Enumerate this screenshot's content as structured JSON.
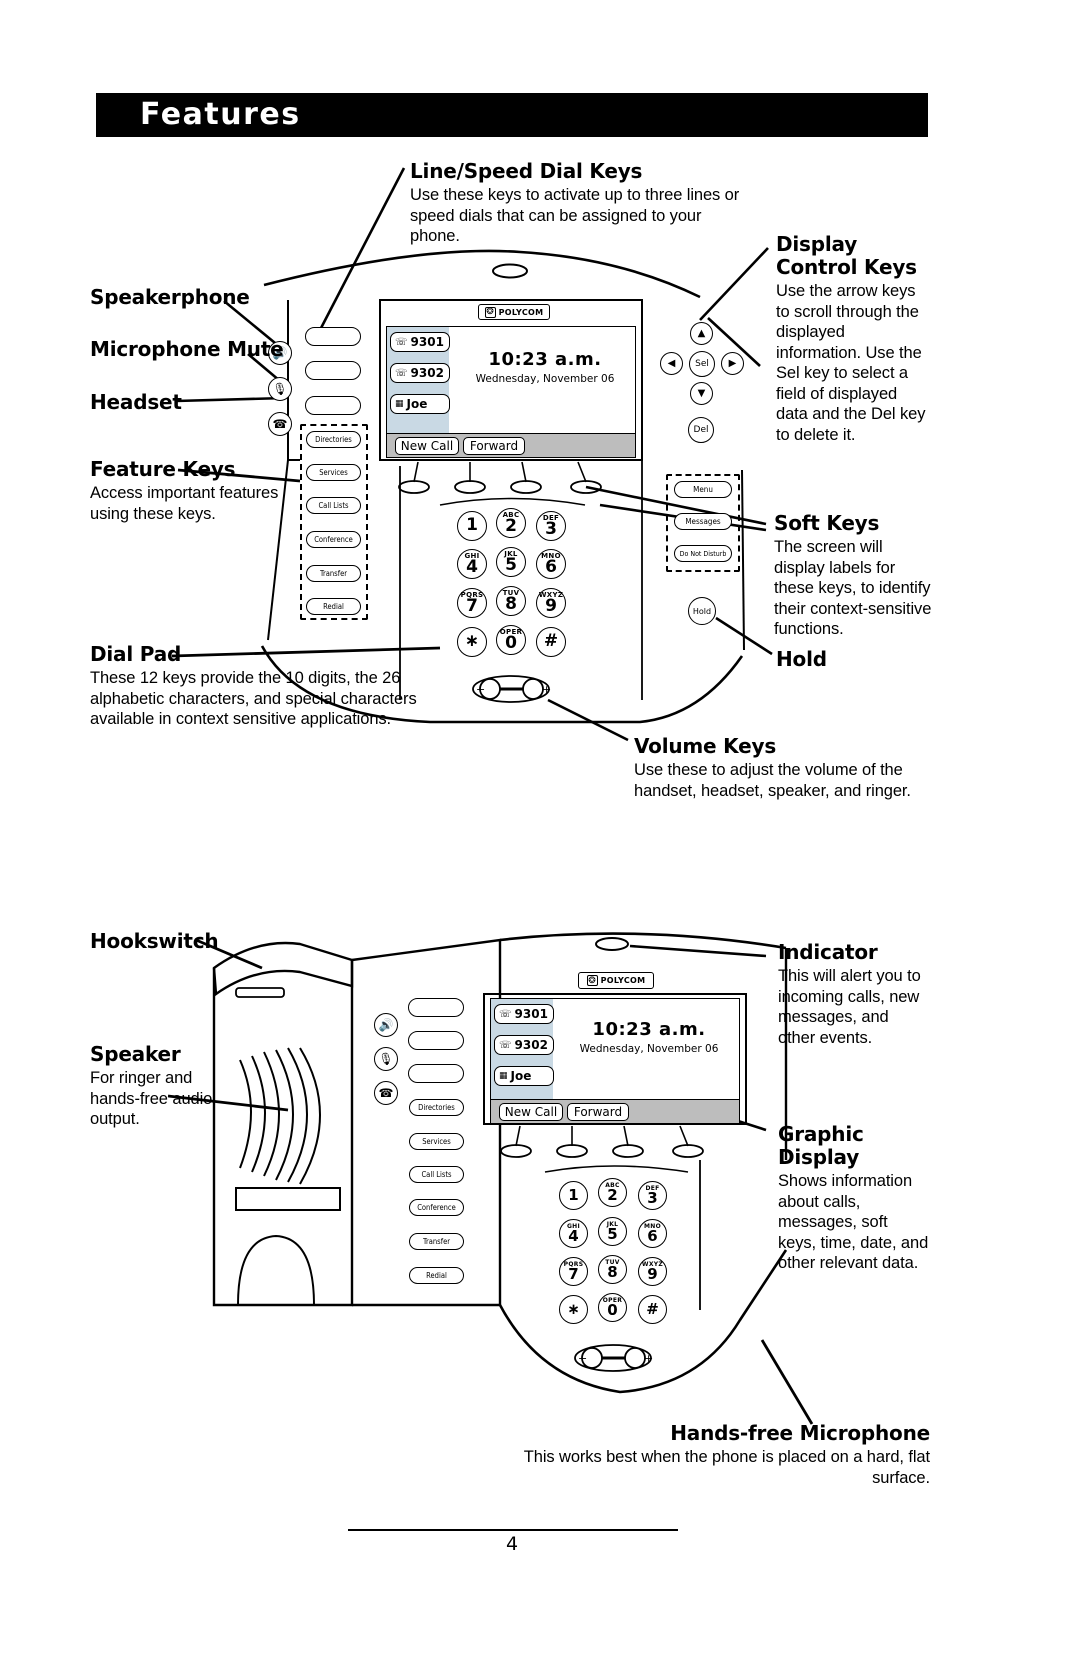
{
  "header": {
    "title": "Features"
  },
  "page_number": "4",
  "callouts": {
    "line_speed_dial": {
      "title": "Line/Speed Dial Keys",
      "body": "Use these keys to activate up to three lines or speed dials that can be assigned to your phone."
    },
    "display_control": {
      "title": "Display Control Keys",
      "body": "Use the arrow keys to scroll through the displayed information. Use the Sel key to select a field of displayed data and the Del key to delete it."
    },
    "speakerphone": {
      "title": "Speakerphone",
      "body": ""
    },
    "microphone_mute": {
      "title": "Microphone Mute",
      "body": ""
    },
    "headset": {
      "title": "Headset",
      "body": ""
    },
    "feature_keys": {
      "title": "Feature Keys",
      "body": "Access important features using these keys."
    },
    "soft_keys": {
      "title": "Soft Keys",
      "body": "The screen will display labels for these keys, to identify their context-sensitive functions."
    },
    "dial_pad": {
      "title": "Dial Pad",
      "body": "These 12 keys provide the 10 digits, the 26 alphabetic characters, and special characters available in context sensitive applications."
    },
    "hold": {
      "title": "Hold",
      "body": ""
    },
    "volume_keys": {
      "title": "Volume Keys",
      "body": "Use these to adjust the volume of the handset, headset, speaker, and ringer."
    },
    "hookswitch": {
      "title": "Hookswitch",
      "body": ""
    },
    "speaker": {
      "title": "Speaker",
      "body": "For ringer and hands-free audio output."
    },
    "indicator": {
      "title": "Indicator",
      "body": "This will alert you to incoming calls, new messages, and other events."
    },
    "graphic_display": {
      "title": "Graphic Display",
      "body": "Shows information about calls, messages, soft keys, time, date, and other relevant data."
    },
    "hands_free_microphone": {
      "title": "Hands-free Microphone",
      "body": "This works best when the phone is placed on a hard, flat surface."
    }
  },
  "phone": {
    "brand": "POLYCOM",
    "brand_mark": "polycom-logo-icon",
    "lcd": {
      "time": "10:23 a.m.",
      "date": "Wednesday, November 06",
      "line_keys": [
        {
          "icon": "handset-icon",
          "label": "9301"
        },
        {
          "icon": "handset-icon",
          "label": "9302"
        },
        {
          "icon": "keypad-icon",
          "label": "Joe"
        }
      ],
      "soft_keys": [
        "New Call",
        "Forward"
      ]
    },
    "side_icon_keys": [
      {
        "name": "speakerphone-icon",
        "glyph": "speaker"
      },
      {
        "name": "microphone-mute-icon",
        "glyph": "mic"
      },
      {
        "name": "headset-icon",
        "glyph": "headset"
      }
    ],
    "feature_keys": [
      "Directories",
      "Services",
      "Call Lists",
      "Conference",
      "Transfer",
      "Redial"
    ],
    "right_keys": [
      "Menu",
      "Messages",
      "Do Not Disturb"
    ],
    "hold_key": "Hold",
    "display_control": {
      "up": "up-arrow-icon",
      "down": "down-arrow-icon",
      "left": "left-arrow-icon",
      "right": "right-arrow-icon",
      "select": "Sel",
      "delete": "Del"
    },
    "dial_pad": [
      {
        "digit": "1",
        "letters": ""
      },
      {
        "digit": "2",
        "letters": "ABC"
      },
      {
        "digit": "3",
        "letters": "DEF"
      },
      {
        "digit": "4",
        "letters": "GHI"
      },
      {
        "digit": "5",
        "letters": "JKL"
      },
      {
        "digit": "6",
        "letters": "MNO"
      },
      {
        "digit": "7",
        "letters": "PQRS"
      },
      {
        "digit": "8",
        "letters": "TUV"
      },
      {
        "digit": "9",
        "letters": "WXYZ"
      },
      {
        "digit": "∗",
        "letters": ""
      },
      {
        "digit": "0",
        "letters": "OPER"
      },
      {
        "digit": "#",
        "letters": ""
      }
    ],
    "volume_rocker": {
      "minus": "−",
      "plus": "+"
    }
  },
  "colors": {
    "ink": "#000000",
    "paper": "#ffffff",
    "lcd_sidebar": "#c9d9e4",
    "softkey_bar": "#bdbdbd"
  }
}
